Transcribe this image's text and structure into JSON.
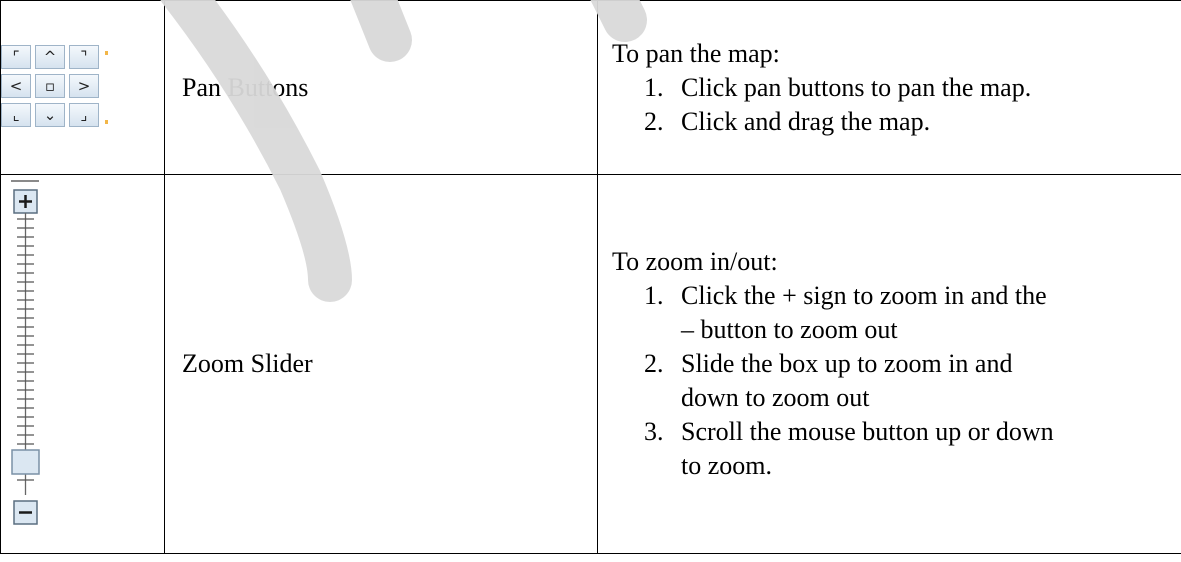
{
  "rows": [
    {
      "name": "Pan Buttons",
      "intro": "To pan the map:",
      "steps": [
        {
          "num": "1.",
          "text": "Click pan buttons to pan the map."
        },
        {
          "num": "2.",
          "text": "Click and drag the map."
        }
      ],
      "icon": "pan-buttons-icon",
      "pan_glyphs": [
        "⌜",
        "^",
        "⌝",
        "<",
        "▫",
        ">",
        "⌞",
        "⌄",
        "⌟"
      ]
    },
    {
      "name": "Zoom Slider",
      "intro": "To zoom in/out:",
      "steps": [
        {
          "num": "1.",
          "line1": "Click the + sign to zoom in and the",
          "line2": "– button to zoom out"
        },
        {
          "num": "2.",
          "line1": "Slide the box up to zoom in and",
          "line2": "down to zoom out"
        },
        {
          "num": "3.",
          "line1": "Scroll the mouse button up or down",
          "line2": "to zoom."
        }
      ],
      "icon": "zoom-slider-icon",
      "zoom_glyphs": {
        "plus": "+",
        "minus": "−"
      }
    }
  ],
  "colors": {
    "watermark": "#d9d9d9",
    "button_border": "#9fb4c8",
    "button_fill": "#dbe7f2"
  }
}
